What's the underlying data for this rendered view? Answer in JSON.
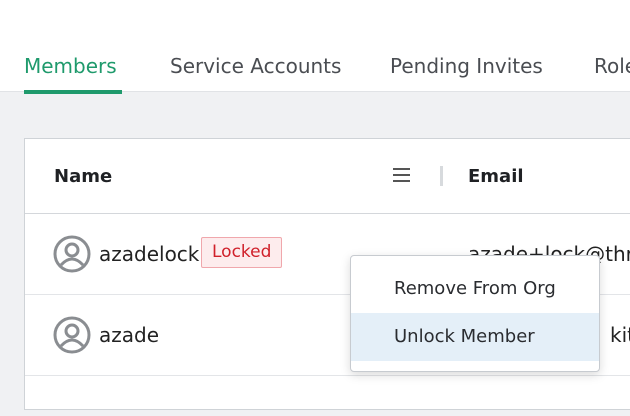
{
  "tabs": [
    {
      "label": "Members",
      "active": true
    },
    {
      "label": "Service Accounts",
      "active": false
    },
    {
      "label": "Pending Invites",
      "active": false
    },
    {
      "label": "Roles",
      "active": false
    }
  ],
  "table": {
    "columns": {
      "name": "Name",
      "email": "Email"
    },
    "column_menu_icon": "hamburger-menu-icon",
    "rows": [
      {
        "name": "azadelock",
        "badge": "Locked",
        "email": "azade+lock@thr"
      },
      {
        "name": "azade",
        "badge": "",
        "email": "kit."
      }
    ]
  },
  "context_menu": {
    "items": [
      {
        "label": "Remove From Org",
        "highlighted": false
      },
      {
        "label": "Unlock Member",
        "highlighted": true
      }
    ]
  },
  "colors": {
    "accent": "#1f9a6c",
    "locked_badge_text": "#d0202a",
    "locked_badge_bg": "#fdeced",
    "menu_highlight": "#e4eff8"
  }
}
